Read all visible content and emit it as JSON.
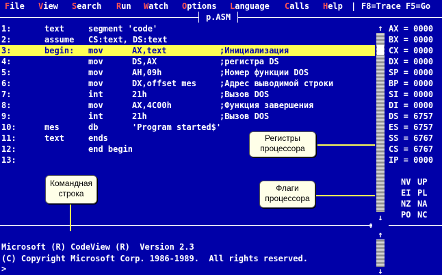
{
  "menu": {
    "items": [
      {
        "hotkey": "F",
        "rest": "ile"
      },
      {
        "hotkey": "V",
        "rest": "iew"
      },
      {
        "hotkey": "S",
        "rest": "earch"
      },
      {
        "hotkey": "R",
        "rest": "un"
      },
      {
        "hotkey": "W",
        "rest": "atch"
      },
      {
        "hotkey": "O",
        "rest": "ptions"
      },
      {
        "hotkey": "L",
        "rest": "anguage"
      },
      {
        "hotkey": "C",
        "rest": "alls"
      },
      {
        "hotkey": "H",
        "rest": "elp"
      }
    ],
    "separator": "|",
    "shortcuts": "F8=Trace F5=Go"
  },
  "source_window": {
    "title": "p.ASM",
    "highlighted_line": 3,
    "lines": [
      {
        "num": "1:",
        "label": "text",
        "op": "segment 'code'",
        "arg": "",
        "comment": ""
      },
      {
        "num": "2:",
        "label": "assume",
        "op": "CS:text, DS:text",
        "arg": "",
        "comment": ""
      },
      {
        "num": "3:",
        "label": "begin:",
        "op": "mov",
        "arg": "AX,text",
        "comment": ";Инициализация"
      },
      {
        "num": "4:",
        "label": "",
        "op": "mov",
        "arg": "DS,AX",
        "comment": ";регистра DS"
      },
      {
        "num": "5:",
        "label": "",
        "op": "mov",
        "arg": "AH,09h",
        "comment": ";Номер функции DOS"
      },
      {
        "num": "6:",
        "label": "",
        "op": "mov",
        "arg": "DX,offset mes",
        "comment": ";Адрес выводимой строки"
      },
      {
        "num": "7:",
        "label": "",
        "op": "int",
        "arg": "21h",
        "comment": ";Вызов DOS"
      },
      {
        "num": "8:",
        "label": "",
        "op": "mov",
        "arg": "AX,4C00h",
        "comment": ";Функция завершения"
      },
      {
        "num": "9:",
        "label": "",
        "op": "int",
        "arg": "21h",
        "comment": ";Вызов DOS"
      },
      {
        "num": "10:",
        "label": "mes",
        "op": "db",
        "arg": "'Program started$'",
        "comment": ""
      },
      {
        "num": "11:",
        "label": "text",
        "op": "ends",
        "arg": "",
        "comment": ""
      },
      {
        "num": "12:",
        "label": "",
        "op": "end begin",
        "arg": "",
        "comment": ""
      },
      {
        "num": "13:",
        "label": "",
        "op": "",
        "arg": "",
        "comment": ""
      }
    ]
  },
  "registers": [
    {
      "name": "AX",
      "value": "0000"
    },
    {
      "name": "BX",
      "value": "0000"
    },
    {
      "name": "CX",
      "value": "0000"
    },
    {
      "name": "DX",
      "value": "0000"
    },
    {
      "name": "SP",
      "value": "0000"
    },
    {
      "name": "BP",
      "value": "0000"
    },
    {
      "name": "SI",
      "value": "0000"
    },
    {
      "name": "DI",
      "value": "0000"
    },
    {
      "name": "DS",
      "value": "6757"
    },
    {
      "name": "ES",
      "value": "6757"
    },
    {
      "name": "SS",
      "value": "6767"
    },
    {
      "name": "CS",
      "value": "6767"
    },
    {
      "name": "IP",
      "value": "0000"
    }
  ],
  "flags": [
    [
      "NV",
      "UP"
    ],
    [
      "EI",
      "PL"
    ],
    [
      "NZ",
      "NA"
    ],
    [
      "PO",
      "NC"
    ]
  ],
  "command_window": {
    "lines": [
      "Microsoft (R) CodeView (R)  Version 2.3",
      "(C) Copyright Microsoft Corp. 1986-1989.  All rights reserved.",
      ">"
    ]
  },
  "callouts": {
    "registers": [
      "Регистры",
      "процессора"
    ],
    "flags": [
      "Флаги",
      "процессора"
    ],
    "command": [
      "Командная",
      "строка"
    ]
  },
  "glyphs": {
    "up_arrow": "↑",
    "down_arrow": "↓",
    "updown_arrow": "↕"
  },
  "colors": {
    "background": "#0000a8",
    "highlight": "#ffff55",
    "hotkey": "#ff5555",
    "text": "#ffffff"
  }
}
